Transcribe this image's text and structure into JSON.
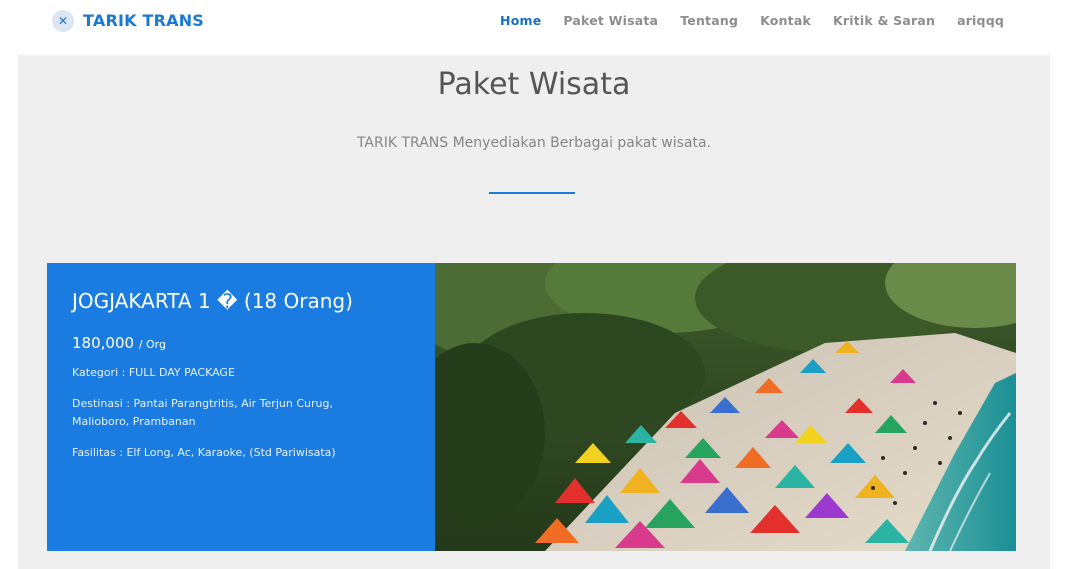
{
  "brand": {
    "name": "TARIK TRANS",
    "logo_icon": "close-icon"
  },
  "nav": {
    "items": [
      {
        "label": "Home",
        "active": true
      },
      {
        "label": "Paket Wisata",
        "active": false
      },
      {
        "label": "Tentang",
        "active": false
      },
      {
        "label": "Kontak",
        "active": false
      },
      {
        "label": "Kritik & Saran",
        "active": false
      },
      {
        "label": "ariqqq",
        "active": false
      }
    ]
  },
  "section": {
    "title": "Paket Wisata",
    "subtitle": "TARIK TRANS Menyediakan Berbagai pakat wisata.",
    "accent_color": "#1f7ad6"
  },
  "package": {
    "title": "JOGJAKARTA 1 � (18 Orang)",
    "price": "180,000",
    "price_unit": "/ Org",
    "category": "Kategori : FULL DAY PACKAGE",
    "destinations": "Destinasi : Pantai Parangtritis, Air Terjun Curug, Malioboro, Prambanan",
    "facilities": "Fasilitas : Elf Long, Ac, Karaoke, (Std Pariwisata)",
    "card_color": "#1a7be1"
  }
}
